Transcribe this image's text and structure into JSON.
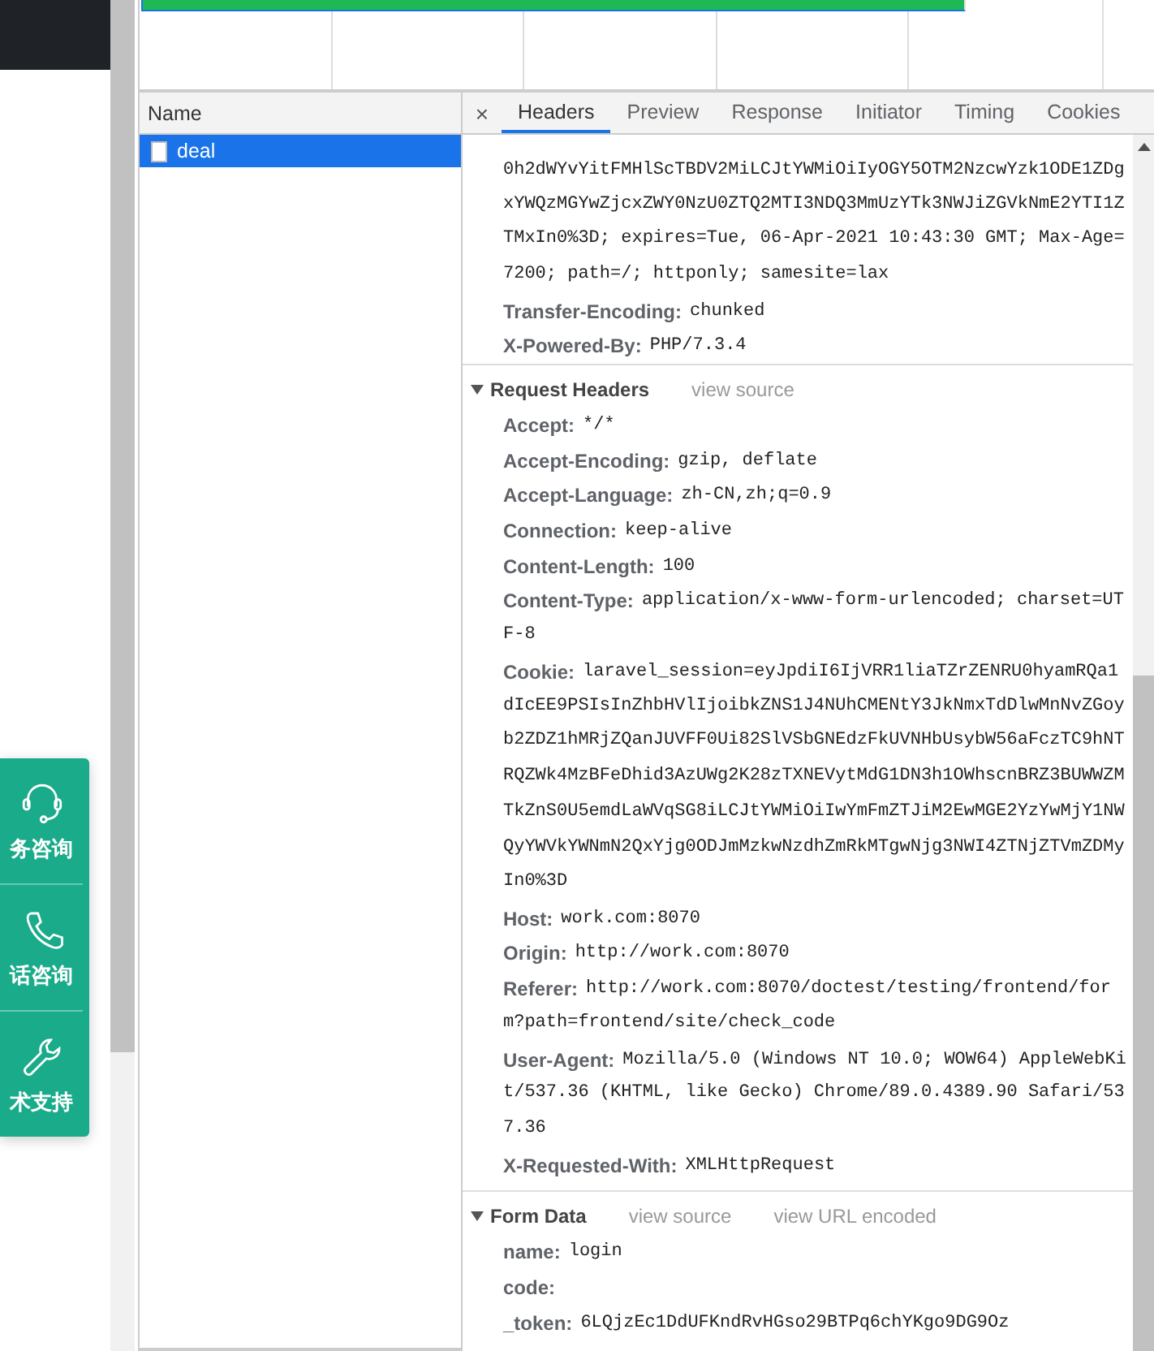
{
  "page": {
    "side_panel": [
      {
        "label": "务咨询"
      },
      {
        "label": "话咨询"
      },
      {
        "label": "术支持"
      }
    ]
  },
  "devtools": {
    "name_column": {
      "header": "Name",
      "requests": [
        {
          "name": "deal",
          "selected": true
        }
      ]
    },
    "details": {
      "close": "×",
      "tabs": [
        {
          "label": "Headers",
          "selected": true
        },
        {
          "label": "Preview",
          "selected": false
        },
        {
          "label": "Response",
          "selected": false
        },
        {
          "label": "Initiator",
          "selected": false
        },
        {
          "label": "Timing",
          "selected": false
        },
        {
          "label": "Cookies",
          "selected": false
        }
      ],
      "response_headers_tail": [
        {
          "value": [
            "0h2dWYvYitFMHlScTBDV2MiLCJtYWMiOiIyOGY5OTM2NzcwYzk1ODE1ZDg",
            "xYWQzMGYwZjcxZWY0NzU0ZTQ2MTI3NDQ3MmUzYTk3NWJiZGVkNmE2YTI1Z",
            "TMxIn0%3D; expires=Tue, 06-Apr-2021 10:43:30 GMT; Max-Age=",
            "7200; path=/; httponly; samesite=lax"
          ]
        },
        {
          "name": "Transfer-Encoding:",
          "value": [
            "chunked"
          ]
        },
        {
          "name": "X-Powered-By:",
          "value": [
            "PHP/7.3.4"
          ]
        }
      ],
      "request_headers": {
        "title": "Request Headers",
        "expanded": true,
        "links": [
          "view source"
        ],
        "headers": [
          {
            "name": "Accept:",
            "value": [
              "*/*"
            ]
          },
          {
            "name": "Accept-Encoding:",
            "value": [
              "gzip, deflate"
            ]
          },
          {
            "name": "Accept-Language:",
            "value": [
              "zh-CN,zh;q=0.9"
            ]
          },
          {
            "name": "Connection:",
            "value": [
              "keep-alive"
            ]
          },
          {
            "name": "Content-Length:",
            "value": [
              "100"
            ]
          },
          {
            "name": "Content-Type:",
            "value": [
              "application/x-www-form-urlencoded; charset=UT",
              "F-8"
            ]
          },
          {
            "name": "Cookie:",
            "value": [
              "laravel_session=eyJpdiI6IjVRR1liaTZrZENRU0hyamRQa1",
              "dIcEE9PSIsInZhbHVlIjoibkZNS1J4NUhCMENtY3JkNmxTdDlwMnNvZGoy",
              "b2ZDZ1hMRjZQanJUVFF0Ui82SlVSbGNEdzFkUVNHbUsybW56aFczTC9hNT",
              "RQZWk4MzBFeDhid3AzUWg2K28zTXNEVytMdG1DN3h1OWhscnBRZ3BUWWZM",
              "TkZnS0U5emdLaWVqSG8iLCJtYWMiOiIwYmFmZTJiM2EwMGE2YzYwMjY1NW",
              "QyYWVkYWNmN2QxYjg0ODJmMzkwNzdhZmRkMTgwNjg3NWI4ZTNjZTVmZDMy",
              "In0%3D"
            ]
          },
          {
            "name": "Host:",
            "value": [
              "work.com:8070"
            ]
          },
          {
            "name": "Origin:",
            "value": [
              "http://work.com:8070"
            ]
          },
          {
            "name": "Referer:",
            "value": [
              "http://work.com:8070/doctest/testing/frontend/for",
              "m?path=frontend/site/check_code"
            ]
          },
          {
            "name": "User-Agent:",
            "value": [
              "Mozilla/5.0 (Windows NT 10.0; WOW64) AppleWebKi",
              "t/537.36 (KHTML, like Gecko) Chrome/89.0.4389.90 Safari/53",
              "7.36"
            ]
          },
          {
            "name": "X-Requested-With:",
            "value": [
              "XMLHttpRequest"
            ]
          }
        ]
      },
      "form_data": {
        "title": "Form Data",
        "expanded": true,
        "links": [
          "view source",
          "view URL encoded"
        ],
        "fields": [
          {
            "name": "name:",
            "value": [
              "login"
            ]
          },
          {
            "name": "code:"
          },
          {
            "name": "_token:",
            "value": [
              "6LQjzEc1DdUFKndRvHGso29BTPq6chYKgo9DG9Oz"
            ]
          }
        ]
      }
    }
  }
}
